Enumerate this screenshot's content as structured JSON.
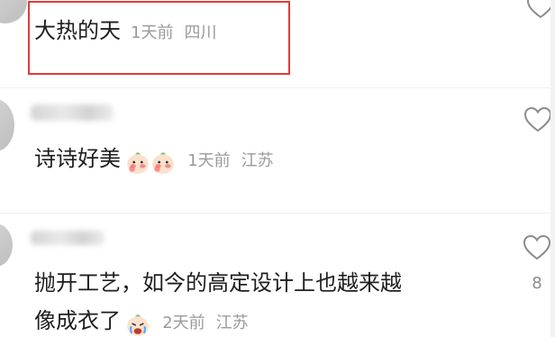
{
  "comments": [
    {
      "text": "大热的天",
      "time": "1天前",
      "location": "四川"
    },
    {
      "text": "诗诗好美",
      "emojis": [
        "peach-face-emoji",
        "peach-face-emoji"
      ],
      "time": "1天前",
      "location": "江苏"
    },
    {
      "text_line1": "抛开工艺，如今的高定设计上也越来越",
      "text_line2": "像成衣了",
      "emojis": [
        "crying-face-emoji"
      ],
      "time": "2天前",
      "location": "江苏",
      "like_count": "8"
    }
  ],
  "icons": {
    "like": "heart-outline-icon"
  },
  "colors": {
    "highlight_box": "#e03a3a",
    "meta_text": "#9a9a9a",
    "main_text": "#1e1e1e"
  }
}
